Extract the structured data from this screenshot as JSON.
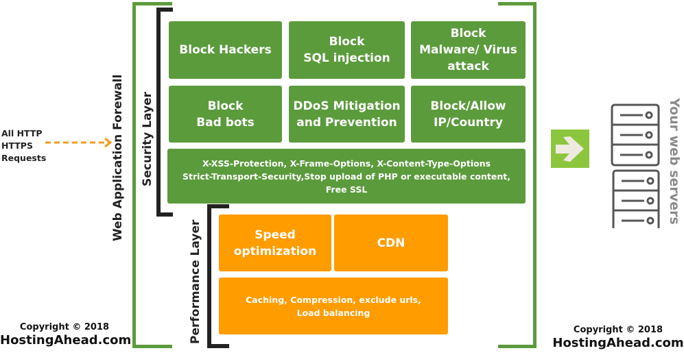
{
  "colors": {
    "security_green": "#5b9b3c",
    "performance_orange": "#ff9c00",
    "frame_green": "#5b9b3c",
    "bracket_dark": "#222222",
    "arrow_orange": "#f39a1e",
    "arrow_tile_green": "#8cc63e",
    "server_gray": "#555555",
    "servers_label_gray": "#8a8a8a"
  },
  "input": {
    "label_lines": [
      "All HTTP",
      "HTTPS",
      "Requests"
    ],
    "arrow_icon": "dashed-arrow-right-icon"
  },
  "waf": {
    "title": "Web Application Forewall",
    "security_layer": {
      "label": "Security Layer",
      "boxes": [
        "Block Hackers",
        "Block\nSQL injection",
        "Block\nMalware/ Virus\nattack",
        "Block\nBad bots",
        "DDoS Mitigation\nand Prevention",
        "Block/Allow\nIP/Country"
      ],
      "wide_box": "X-XSS-Protection, X-Frame-Options, X-Content-Type-Options\nStrict-Transport-Security,Stop upload of PHP or executable content,\nFree SSL"
    },
    "performance_layer": {
      "label": "Performance Layer",
      "boxes": [
        "Speed\noptimization",
        "CDN"
      ],
      "wide_box": "Caching, Compression, exclude urls,\nLoad balancing"
    }
  },
  "output": {
    "arrow_icon": "arrow-right-icon",
    "servers_icon": "server-rack-icon",
    "label": "Your web servers"
  },
  "copyright_left": {
    "line1": "Copyright © 2018",
    "line2": "HostingAhead.com"
  },
  "copyright_right": {
    "line1": "Copyright © 2018",
    "line2": "HostingAhead.com"
  }
}
